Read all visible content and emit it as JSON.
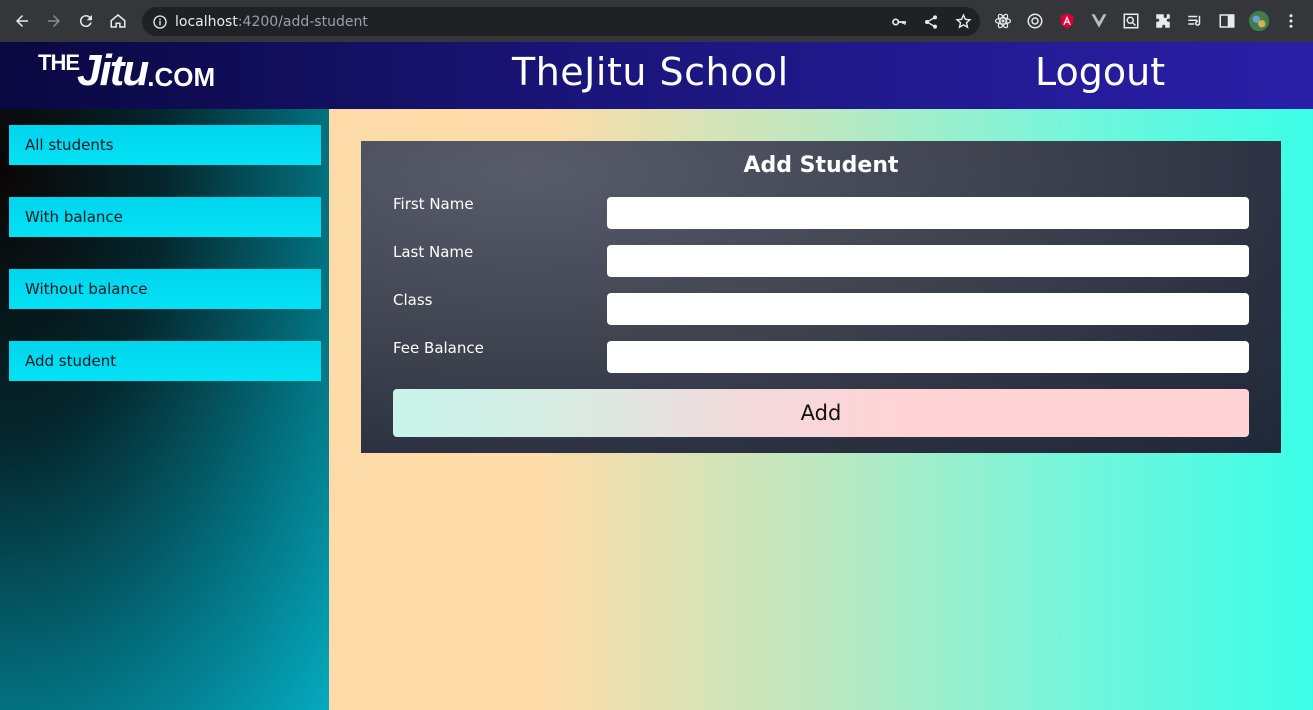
{
  "browser": {
    "url_host": "localhost",
    "url_path": ":4200/add-student"
  },
  "header": {
    "logo_the": "THE",
    "logo_jitu": "Jitu",
    "logo_com": ".COM",
    "title": "TheJitu School",
    "logout": "Logout"
  },
  "sidebar": {
    "items": [
      {
        "label": "All students"
      },
      {
        "label": "With balance"
      },
      {
        "label": "Without balance"
      },
      {
        "label": "Add student"
      }
    ]
  },
  "form": {
    "title": "Add Student",
    "fields": [
      {
        "label": "First Name",
        "value": ""
      },
      {
        "label": "Last Name",
        "value": ""
      },
      {
        "label": "Class",
        "value": ""
      },
      {
        "label": "Fee Balance",
        "value": ""
      }
    ],
    "submit_label": "Add"
  },
  "colors": {
    "header_start": "#0a0840",
    "header_end": "#2a1fa8",
    "sidebar_item": "#00d5ee",
    "card": "#3f4350",
    "add_button": "#ffd3d6"
  }
}
